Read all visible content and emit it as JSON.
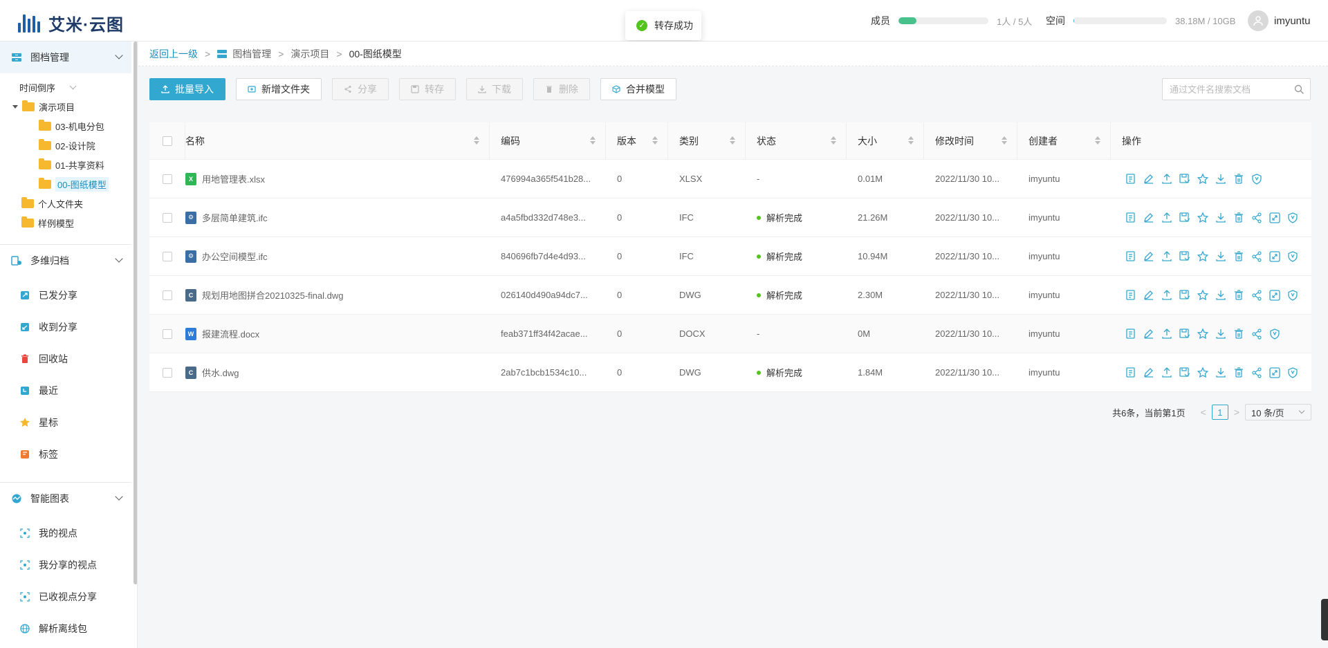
{
  "app": {
    "logo_text": "艾米·云图"
  },
  "toast": {
    "message": "转存成功"
  },
  "quota": {
    "members": {
      "label": "成员",
      "value": "1人 / 5人",
      "fraction": 0.2,
      "color": "#48c28a"
    },
    "space": {
      "label": "空间",
      "value": "38.18M / 10GB",
      "fraction": 0.004,
      "color": "#32a7d0"
    }
  },
  "user": {
    "name": "imyuntu"
  },
  "sidebar": {
    "sections": {
      "archive": {
        "label": "图档管理"
      },
      "multi": {
        "label": "多维归档"
      },
      "smart": {
        "label": "智能图表"
      }
    },
    "tree": {
      "sort_label": "时间倒序",
      "project": "演示项目",
      "children": [
        "03-机电分包",
        "02-设计院",
        "01-共享资料",
        "00-图纸模型"
      ],
      "personal": "个人文件夹",
      "samples": "样例模型"
    },
    "multi_items": [
      "已发分享",
      "收到分享",
      "回收站",
      "最近",
      "星标",
      "标签"
    ],
    "smart_items": [
      "我的视点",
      "我分享的视点",
      "已收视点分享",
      "解析离线包"
    ]
  },
  "breadcrumb": {
    "back": "返回上一级",
    "sep": ">",
    "items": [
      "图档管理",
      "演示项目",
      "00-图纸模型"
    ]
  },
  "toolbar": {
    "import": "批量导入",
    "new_folder": "新增文件夹",
    "share": "分享",
    "transfer": "转存",
    "download": "下载",
    "delete": "删除",
    "merge": "合并模型"
  },
  "search": {
    "placeholder": "通过文件名搜索文档"
  },
  "table": {
    "headers": {
      "name": "名称",
      "code": "编码",
      "version": "版本",
      "type": "类别",
      "status": "状态",
      "size": "大小",
      "modified": "修改时间",
      "creator": "创建者",
      "actions": "操作"
    },
    "rows": [
      {
        "name": "用地管理表.xlsx",
        "code": "476994a365f541b28...",
        "version": "0",
        "type": "XLSX",
        "status": "-",
        "size": "0.01M",
        "modified": "2022/11/30 10...",
        "creator": "imyuntu"
      },
      {
        "name": "多层简单建筑.ifc",
        "code": "a4a5fbd332d748e3...",
        "version": "0",
        "type": "IFC",
        "status": "解析完成",
        "size": "21.26M",
        "modified": "2022/11/30 10...",
        "creator": "imyuntu"
      },
      {
        "name": "办公空间模型.ifc",
        "code": "840696fb7d4e4d93...",
        "version": "0",
        "type": "IFC",
        "status": "解析完成",
        "size": "10.94M",
        "modified": "2022/11/30 10...",
        "creator": "imyuntu"
      },
      {
        "name": "规划用地图拼合20210325-final.dwg",
        "code": "026140d490a94dc7...",
        "version": "0",
        "type": "DWG",
        "status": "解析完成",
        "size": "2.30M",
        "modified": "2022/11/30 10...",
        "creator": "imyuntu"
      },
      {
        "name": "报建流程.docx",
        "code": "feab371ff34f42acae...",
        "version": "0",
        "type": "DOCX",
        "status": "-",
        "size": "0M",
        "modified": "2022/11/30 10...",
        "creator": "imyuntu"
      },
      {
        "name": "供水.dwg",
        "code": "2ab7c1bcb1534c10...",
        "version": "0",
        "type": "DWG",
        "status": "解析完成",
        "size": "1.84M",
        "modified": "2022/11/30 10...",
        "creator": "imyuntu"
      }
    ]
  },
  "pagination": {
    "summary": "共6条，当前第1页",
    "prev": "<",
    "page": "1",
    "next": ">",
    "page_size": "10 条/页"
  },
  "colors": {
    "accent": "#32a7d0",
    "success": "#52c41a",
    "folder": "#f5b82e"
  }
}
